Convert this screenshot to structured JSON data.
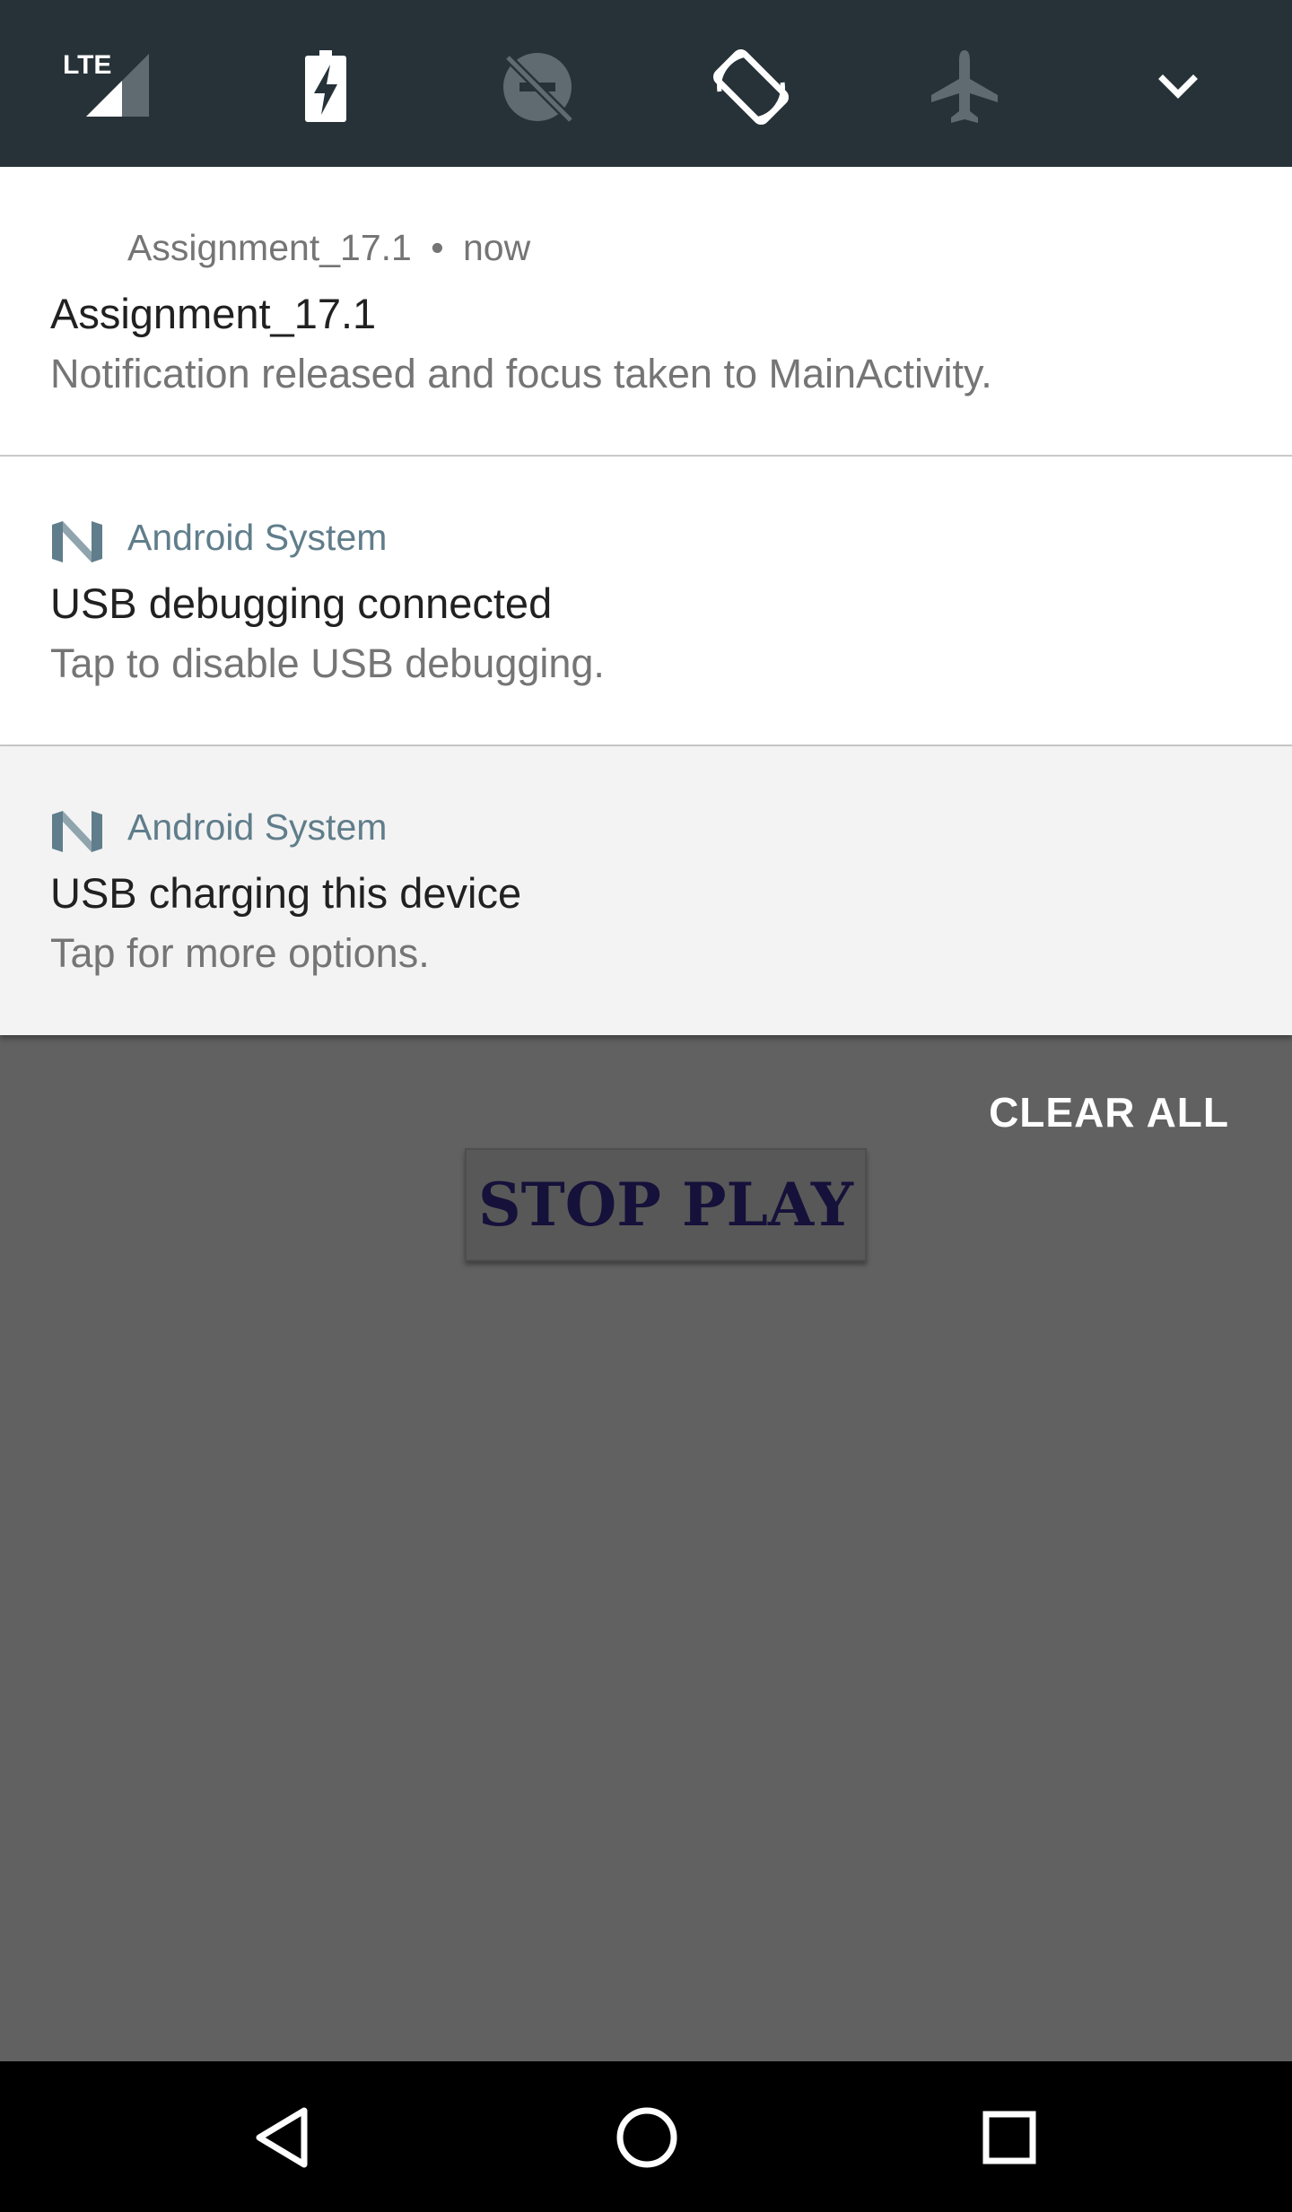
{
  "quick_settings": {
    "tiles": [
      {
        "icon": "lte-signal-icon",
        "label": "LTE"
      },
      {
        "icon": "battery-charging-icon"
      },
      {
        "icon": "do-not-disturb-off-icon"
      },
      {
        "icon": "auto-rotate-icon"
      },
      {
        "icon": "airplane-mode-icon"
      },
      {
        "icon": "expand-chevron-icon"
      }
    ],
    "colors": {
      "background": "#263238",
      "active": "#ffffff",
      "inactive": "#5f6b70"
    }
  },
  "notifications": [
    {
      "app_name": "Assignment_17.1",
      "separator": "•",
      "time": "now",
      "title": "Assignment_17.1",
      "text": "Notification released and focus taken to MainActivity."
    },
    {
      "app_icon": "android-n-logo-icon",
      "app_name": "Android System",
      "title": "USB debugging connected",
      "text": "Tap to disable USB debugging."
    },
    {
      "app_icon": "android-n-logo-icon",
      "app_name": "Android System",
      "title": "USB charging this device",
      "text": "Tap for more options."
    }
  ],
  "shade": {
    "clear_all_label": "CLEAR ALL"
  },
  "app": {
    "stop_button_label": "STOP PLAY"
  },
  "navigation": {
    "back_icon": "back-triangle-icon",
    "home_icon": "home-circle-icon",
    "recents_icon": "recents-square-icon"
  }
}
